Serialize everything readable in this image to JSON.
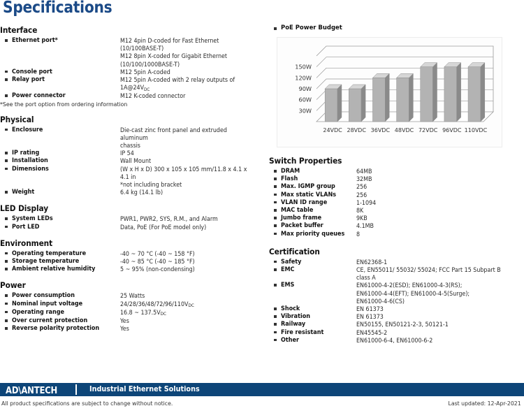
{
  "title": "Specifications",
  "left_column": [
    {
      "heading": "Interface",
      "rows": [
        {
          "label": "Ethernet port*",
          "value": "M12 4pin D-coded for Fast Ethernet (10/100BASE-T)\nM12 8pin X-coded for Gigabit Ethernet\n(10/100/1000BASE-T)"
        },
        {
          "label": "Console port",
          "value": "M12 5pin A-coded"
        },
        {
          "label": "Relay port",
          "value": "M12 5pin A-coded with 2 relay outputs of 1A@24VDC"
        },
        {
          "label": "Power connector",
          "value": "M12 K-coded connector"
        }
      ],
      "note": "*See the port option from ordering information"
    },
    {
      "heading": "Physical",
      "rows": [
        {
          "label": "Enclosure",
          "value": "Die-cast zinc front panel and extruded aluminum\nchassis"
        },
        {
          "label": "IP rating",
          "value": "IP 54"
        },
        {
          "label": "Installation",
          "value": "Wall Mount"
        },
        {
          "label": "Dimensions",
          "value": "(W x H x D) 300 x 105 x 105 mm/11.8 x 4.1 x 4.1 in\n*not including bracket"
        },
        {
          "label": "Weight",
          "value": "6.4 kg (14.1 lb)"
        }
      ]
    },
    {
      "heading": "LED Display",
      "rows": [
        {
          "label": "System LEDs",
          "value": "PWR1, PWR2, SYS, R.M., and Alarm"
        },
        {
          "label": "Port LED",
          "value": "Data, PoE (For PoE model only)"
        }
      ]
    },
    {
      "heading": "Environment",
      "rows": [
        {
          "label": "Operating temperature",
          "value": "-40 ~ 70 °C (-40 ~ 158 °F)"
        },
        {
          "label": "Storage temperature",
          "value": "-40 ~ 85 °C (-40 ~ 185 °F)"
        },
        {
          "label": "Ambient relative humidity",
          "value": "5 ~ 95% (non-condensing)"
        }
      ]
    },
    {
      "heading": "Power",
      "rows": [
        {
          "label": "Power consumption",
          "value": "25 Watts"
        },
        {
          "label": "Nominal input voltage",
          "value": "24/28/36/48/72/96/110VDC"
        },
        {
          "label": "Operating range",
          "value": "16.8 ~ 137.5VDC"
        },
        {
          "label": "Over current protection",
          "value": "Yes"
        },
        {
          "label": "Reverse polarity protection",
          "value": "Yes"
        }
      ]
    }
  ],
  "right_column": [
    {
      "heading": "Switch Properties",
      "rows": [
        {
          "label": "DRAM",
          "value": "64MB"
        },
        {
          "label": "Flash",
          "value": "32MB"
        },
        {
          "label": "Max. IGMP group",
          "value": "256"
        },
        {
          "label": "Max static VLANs",
          "value": "256"
        },
        {
          "label": "VLAN ID range",
          "value": "1-1094"
        },
        {
          "label": "MAC table",
          "value": "8K"
        },
        {
          "label": "Jumbo frame",
          "value": "9KB"
        },
        {
          "label": "Packet buffer",
          "value": "4.1MB"
        },
        {
          "label": "Max priority queues",
          "value": "8"
        }
      ]
    },
    {
      "heading": "Certification",
      "rows": [
        {
          "label": "Safety",
          "value": "EN62368-1"
        },
        {
          "label": "EMC",
          "value": "CE, EN55011/ 55032/ 55024; FCC Part 15 Subpart B class A"
        },
        {
          "label": "EMS",
          "value": "EN61000-4-2(ESD); EN61000-4-3(RS);\nEN61000-4-4(EFT); EN61000-4-5(Surge);\nEN61000-4-6(CS)"
        },
        {
          "label": "Shock",
          "value": "EN 61373"
        },
        {
          "label": "Vibration",
          "value": "EN 61373"
        },
        {
          "label": "Railway",
          "value": "EN50155, EN50121-2-3, 50121-1"
        },
        {
          "label": "Fire resistant",
          "value": "EN45545-2"
        },
        {
          "label": "Other",
          "value": "EN61000-6-4, EN61000-6-2"
        }
      ]
    }
  ],
  "chart_data": {
    "type": "bar",
    "title": "PoE Power Budget",
    "categories": [
      "24VDC",
      "28VDC",
      "36VDC",
      "48VDC",
      "72VDC",
      "96VDC",
      "110VDC"
    ],
    "values": [
      90,
      90,
      120,
      120,
      150,
      150,
      150
    ],
    "ytick_labels": [
      "30W",
      "60W",
      "90W",
      "120W",
      "150W"
    ],
    "yticks": [
      30,
      60,
      90,
      120,
      150
    ],
    "ylim": [
      0,
      180
    ],
    "xlabel": "",
    "ylabel": "",
    "grid": true,
    "legend": "none",
    "bar_color": "#b3b3b3",
    "bar_side_color": "#8a8a8a",
    "bar_top_color": "#d6d6d6"
  },
  "footer": {
    "logo": "AD\\ANTECH",
    "tagline": "Industrial Ethernet Solutions",
    "disclaimer": "All product specifications are subject to change without notice.",
    "updated": "Last updated: 12-Apr-2021",
    "band_color": "#0d4578"
  }
}
